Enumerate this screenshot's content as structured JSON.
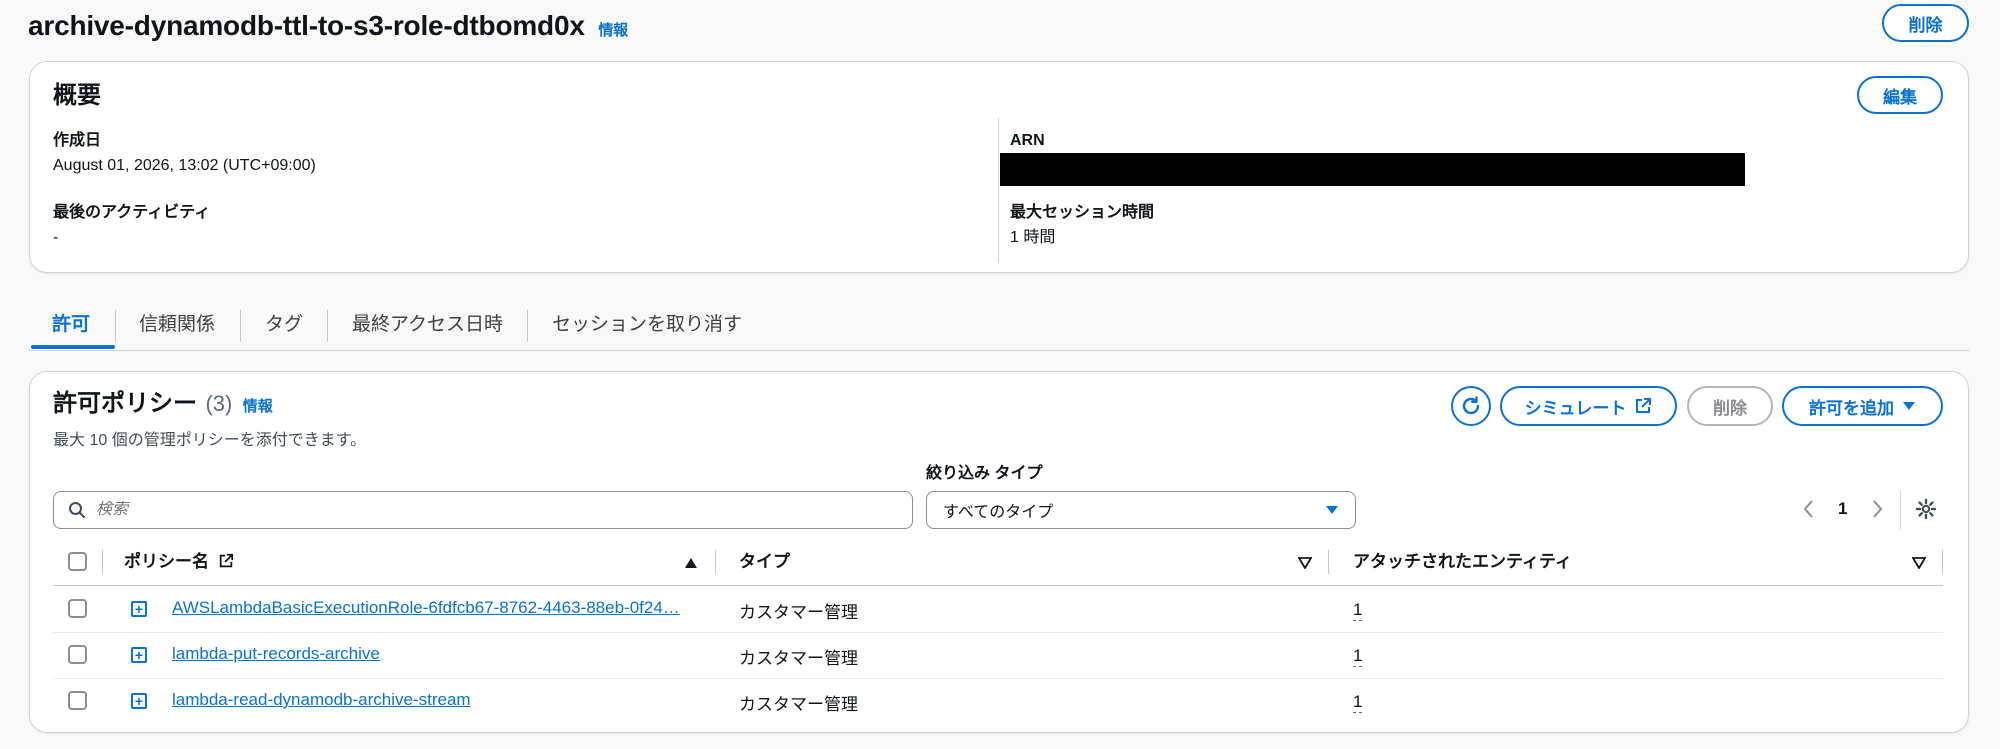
{
  "header": {
    "title": "archive-dynamodb-ttl-to-s3-role-dtbomd0x",
    "info": "情報",
    "delete_label": "削除"
  },
  "summary": {
    "title": "概要",
    "edit_label": "編集",
    "created_label": "作成日",
    "created_value": "August 01, 2026, 13:02 (UTC+09:00)",
    "last_activity_label": "最後のアクティビティ",
    "last_activity_value": "-",
    "arn_label": "ARN",
    "max_session_label": "最大セッション時間",
    "max_session_value": "1 時間"
  },
  "tabs": [
    {
      "label": "許可",
      "active": true
    },
    {
      "label": "信頼関係",
      "active": false
    },
    {
      "label": "タグ",
      "active": false
    },
    {
      "label": "最終アクセス日時",
      "active": false
    },
    {
      "label": "セッションを取り消す",
      "active": false
    }
  ],
  "policies": {
    "title": "許可ポリシー",
    "count": "(3)",
    "info": "情報",
    "description": "最大 10 個の管理ポリシーを添付できます。",
    "simulate_label": "シミュレート",
    "delete_label": "削除",
    "add_label": "許可を追加",
    "search_placeholder": "検索",
    "filter_label": "絞り込み タイプ",
    "filter_value": "すべてのタイプ",
    "page": "1",
    "columns": {
      "name": "ポリシー名",
      "type": "タイプ",
      "entities": "アタッチされたエンティティ"
    },
    "rows": [
      {
        "name": "AWSLambdaBasicExecutionRole-6fdfcb67-8762-4463-88eb-0f24…",
        "type": "カスタマー管理",
        "entities": "1"
      },
      {
        "name": "lambda-put-records-archive",
        "type": "カスタマー管理",
        "entities": "1"
      },
      {
        "name": "lambda-read-dynamodb-archive-stream",
        "type": "カスタマー管理",
        "entities": "1"
      }
    ]
  },
  "colors": {
    "accent": "#0972d3",
    "redacted": "#000000",
    "disabled": "#8c8c94"
  }
}
